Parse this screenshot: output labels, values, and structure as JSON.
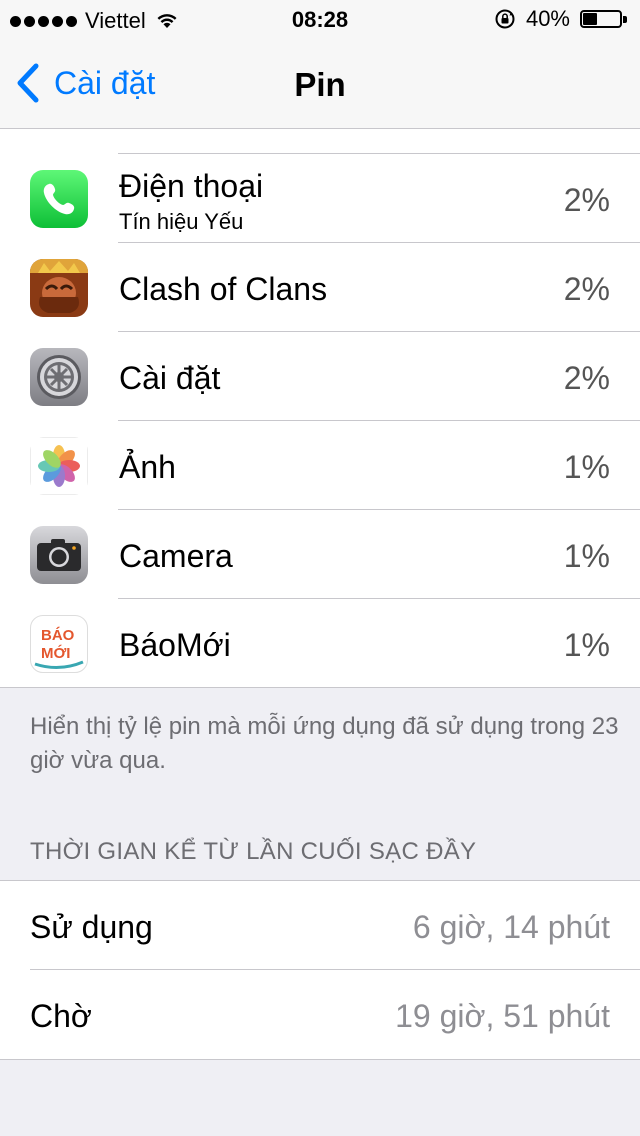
{
  "status_bar": {
    "carrier": "Viettel",
    "time": "08:28",
    "battery_percent_label": "40%",
    "battery_level": 0.4
  },
  "nav": {
    "back_label": "Cài đặt",
    "title": "Pin"
  },
  "apps": [
    {
      "name": "Điện thoại",
      "subtitle": "Tín hiệu Yếu",
      "percent": "2%",
      "icon": "phone-icon"
    },
    {
      "name": "Clash of Clans",
      "percent": "2%",
      "icon": "clash-of-clans-icon"
    },
    {
      "name": "Cài đặt",
      "percent": "2%",
      "icon": "settings-icon"
    },
    {
      "name": "Ảnh",
      "percent": "1%",
      "icon": "photos-icon"
    },
    {
      "name": "Camera",
      "percent": "1%",
      "icon": "camera-icon"
    },
    {
      "name": "BáoMới",
      "percent": "1%",
      "icon": "baomoi-icon"
    }
  ],
  "baomoi_logo_text": [
    "BÁO",
    "MỚI"
  ],
  "footer_note": "Hiển thị tỷ lệ pin mà mỗi ứng dụng đã sử dụng trong 23 giờ vừa qua.",
  "section_header": "THỜI GIAN KỂ TỪ LẦN CUỐI SẠC ĐẦY",
  "usage": [
    {
      "label": "Sử dụng",
      "value": "6 giờ, 14 phút"
    },
    {
      "label": "Chờ",
      "value": "19 giờ, 51 phút"
    }
  ]
}
